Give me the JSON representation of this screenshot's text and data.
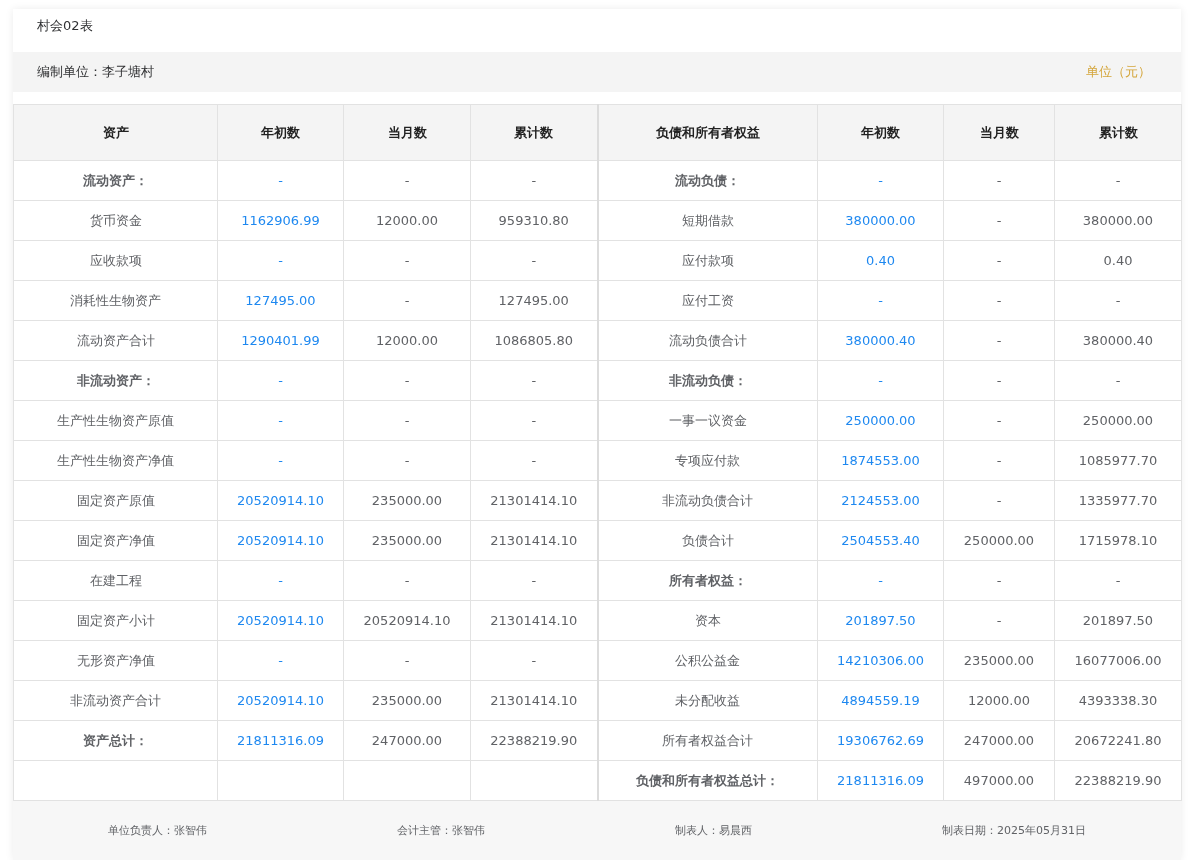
{
  "report_code": "村会02表",
  "info_bar": {
    "unit_label": "编制单位：李子塘村",
    "currency_label": "单位（元）"
  },
  "table": {
    "columns": [
      "资产",
      "年初数",
      "当月数",
      "累计数",
      "负债和所有者权益",
      "年初数",
      "当月数",
      "累计数"
    ],
    "rows": [
      {
        "left": {
          "label": "流动资产：",
          "kind": "heading",
          "values": [
            "-",
            "-",
            "-"
          ]
        },
        "right": {
          "label": "流动负债：",
          "kind": "heading",
          "values": [
            "-",
            "-",
            "-"
          ]
        }
      },
      {
        "left": {
          "label": "货币资金",
          "kind": "item",
          "values": [
            "1162906.99",
            "12000.00",
            "959310.80"
          ]
        },
        "right": {
          "label": "短期借款",
          "kind": "item",
          "values": [
            "380000.00",
            "-",
            "380000.00"
          ]
        }
      },
      {
        "left": {
          "label": "应收款项",
          "kind": "item",
          "values": [
            "-",
            "-",
            "-"
          ]
        },
        "right": {
          "label": "应付款项",
          "kind": "item",
          "values": [
            "0.40",
            "-",
            "0.40"
          ]
        }
      },
      {
        "left": {
          "label": "消耗性生物资产",
          "kind": "item",
          "values": [
            "127495.00",
            "-",
            "127495.00"
          ]
        },
        "right": {
          "label": "应付工资",
          "kind": "item",
          "values": [
            "-",
            "-",
            "-"
          ]
        }
      },
      {
        "left": {
          "label": "流动资产合计",
          "kind": "item",
          "values": [
            "1290401.99",
            "12000.00",
            "1086805.80"
          ]
        },
        "right": {
          "label": "流动负债合计",
          "kind": "item",
          "values": [
            "380000.40",
            "-",
            "380000.40"
          ]
        }
      },
      {
        "left": {
          "label": "非流动资产：",
          "kind": "heading",
          "values": [
            "-",
            "-",
            "-"
          ]
        },
        "right": {
          "label": "非流动负债：",
          "kind": "heading",
          "values": [
            "-",
            "-",
            "-"
          ]
        }
      },
      {
        "left": {
          "label": "生产性生物资产原值",
          "kind": "item",
          "values": [
            "-",
            "-",
            "-"
          ]
        },
        "right": {
          "label": "一事一议资金",
          "kind": "item",
          "values": [
            "250000.00",
            "-",
            "250000.00"
          ]
        }
      },
      {
        "left": {
          "label": "生产性生物资产净值",
          "kind": "item",
          "values": [
            "-",
            "-",
            "-"
          ]
        },
        "right": {
          "label": "专项应付款",
          "kind": "item",
          "values": [
            "1874553.00",
            "-",
            "1085977.70"
          ]
        }
      },
      {
        "left": {
          "label": "固定资产原值",
          "kind": "item",
          "values": [
            "20520914.10",
            "235000.00",
            "21301414.10"
          ]
        },
        "right": {
          "label": "非流动负债合计",
          "kind": "item",
          "values": [
            "2124553.00",
            "-",
            "1335977.70"
          ]
        }
      },
      {
        "left": {
          "label": "固定资产净值",
          "kind": "item",
          "values": [
            "20520914.10",
            "235000.00",
            "21301414.10"
          ]
        },
        "right": {
          "label": "负债合计",
          "kind": "item",
          "values": [
            "2504553.40",
            "250000.00",
            "1715978.10"
          ]
        }
      },
      {
        "left": {
          "label": "在建工程",
          "kind": "item",
          "values": [
            "-",
            "-",
            "-"
          ]
        },
        "right": {
          "label": "所有者权益：",
          "kind": "heading",
          "values": [
            "-",
            "-",
            "-"
          ]
        }
      },
      {
        "left": {
          "label": "固定资产小计",
          "kind": "item",
          "values": [
            "20520914.10",
            "20520914.10",
            "21301414.10"
          ]
        },
        "right": {
          "label": "资本",
          "kind": "item",
          "values": [
            "201897.50",
            "-",
            "201897.50"
          ]
        }
      },
      {
        "left": {
          "label": "无形资产净值",
          "kind": "item",
          "values": [
            "-",
            "-",
            "-"
          ]
        },
        "right": {
          "label": "公积公益金",
          "kind": "item",
          "values": [
            "14210306.00",
            "235000.00",
            "16077006.00"
          ]
        }
      },
      {
        "left": {
          "label": "非流动资产合计",
          "kind": "item",
          "values": [
            "20520914.10",
            "235000.00",
            "21301414.10"
          ]
        },
        "right": {
          "label": "未分配收益",
          "kind": "item",
          "values": [
            "4894559.19",
            "12000.00",
            "4393338.30"
          ]
        }
      },
      {
        "left": {
          "label": "资产总计：",
          "kind": "heading",
          "values": [
            "21811316.09",
            "247000.00",
            "22388219.90"
          ]
        },
        "right": {
          "label": "所有者权益合计",
          "kind": "item",
          "values": [
            "19306762.69",
            "247000.00",
            "20672241.80"
          ]
        }
      },
      {
        "left": null,
        "right": {
          "label": "负债和所有者权益总计：",
          "kind": "heading",
          "values": [
            "21811316.09",
            "497000.00",
            "22388219.90"
          ]
        }
      }
    ]
  },
  "footer": [
    "单位负责人：张智伟",
    "会计主管：张智伟",
    "制表人：易晨西",
    "制表日期：2025年05月31日"
  ]
}
